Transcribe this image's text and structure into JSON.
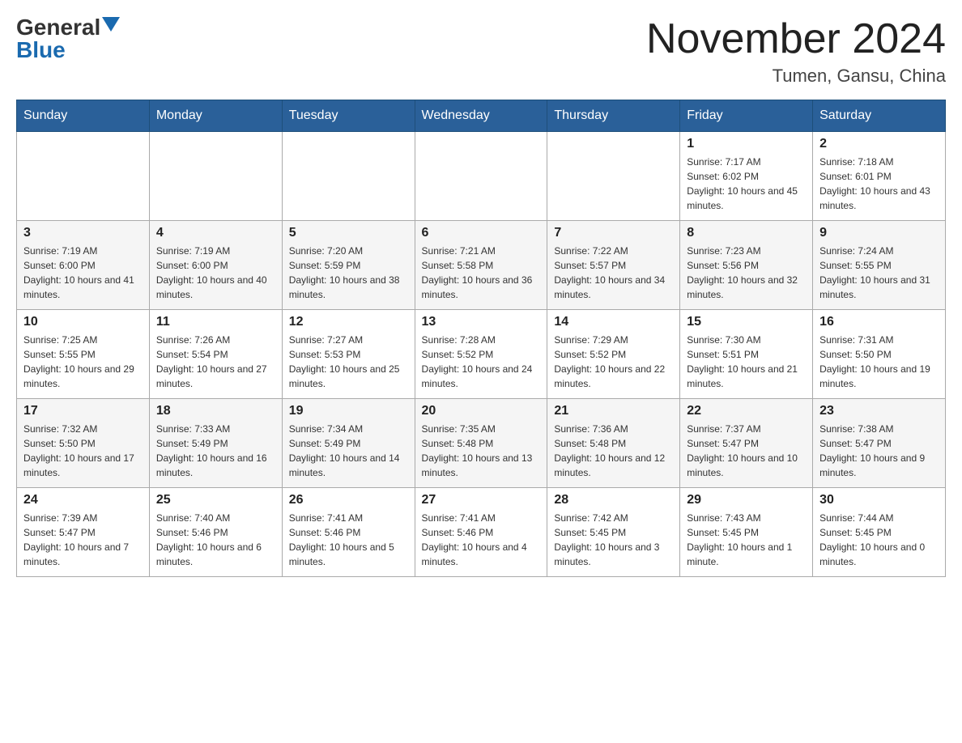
{
  "header": {
    "logo_general": "General",
    "logo_blue": "Blue",
    "month_title": "November 2024",
    "location": "Tumen, Gansu, China"
  },
  "weekdays": [
    "Sunday",
    "Monday",
    "Tuesday",
    "Wednesday",
    "Thursday",
    "Friday",
    "Saturday"
  ],
  "weeks": [
    [
      {
        "day": "",
        "sunrise": "",
        "sunset": "",
        "daylight": ""
      },
      {
        "day": "",
        "sunrise": "",
        "sunset": "",
        "daylight": ""
      },
      {
        "day": "",
        "sunrise": "",
        "sunset": "",
        "daylight": ""
      },
      {
        "day": "",
        "sunrise": "",
        "sunset": "",
        "daylight": ""
      },
      {
        "day": "",
        "sunrise": "",
        "sunset": "",
        "daylight": ""
      },
      {
        "day": "1",
        "sunrise": "Sunrise: 7:17 AM",
        "sunset": "Sunset: 6:02 PM",
        "daylight": "Daylight: 10 hours and 45 minutes."
      },
      {
        "day": "2",
        "sunrise": "Sunrise: 7:18 AM",
        "sunset": "Sunset: 6:01 PM",
        "daylight": "Daylight: 10 hours and 43 minutes."
      }
    ],
    [
      {
        "day": "3",
        "sunrise": "Sunrise: 7:19 AM",
        "sunset": "Sunset: 6:00 PM",
        "daylight": "Daylight: 10 hours and 41 minutes."
      },
      {
        "day": "4",
        "sunrise": "Sunrise: 7:19 AM",
        "sunset": "Sunset: 6:00 PM",
        "daylight": "Daylight: 10 hours and 40 minutes."
      },
      {
        "day": "5",
        "sunrise": "Sunrise: 7:20 AM",
        "sunset": "Sunset: 5:59 PM",
        "daylight": "Daylight: 10 hours and 38 minutes."
      },
      {
        "day": "6",
        "sunrise": "Sunrise: 7:21 AM",
        "sunset": "Sunset: 5:58 PM",
        "daylight": "Daylight: 10 hours and 36 minutes."
      },
      {
        "day": "7",
        "sunrise": "Sunrise: 7:22 AM",
        "sunset": "Sunset: 5:57 PM",
        "daylight": "Daylight: 10 hours and 34 minutes."
      },
      {
        "day": "8",
        "sunrise": "Sunrise: 7:23 AM",
        "sunset": "Sunset: 5:56 PM",
        "daylight": "Daylight: 10 hours and 32 minutes."
      },
      {
        "day": "9",
        "sunrise": "Sunrise: 7:24 AM",
        "sunset": "Sunset: 5:55 PM",
        "daylight": "Daylight: 10 hours and 31 minutes."
      }
    ],
    [
      {
        "day": "10",
        "sunrise": "Sunrise: 7:25 AM",
        "sunset": "Sunset: 5:55 PM",
        "daylight": "Daylight: 10 hours and 29 minutes."
      },
      {
        "day": "11",
        "sunrise": "Sunrise: 7:26 AM",
        "sunset": "Sunset: 5:54 PM",
        "daylight": "Daylight: 10 hours and 27 minutes."
      },
      {
        "day": "12",
        "sunrise": "Sunrise: 7:27 AM",
        "sunset": "Sunset: 5:53 PM",
        "daylight": "Daylight: 10 hours and 25 minutes."
      },
      {
        "day": "13",
        "sunrise": "Sunrise: 7:28 AM",
        "sunset": "Sunset: 5:52 PM",
        "daylight": "Daylight: 10 hours and 24 minutes."
      },
      {
        "day": "14",
        "sunrise": "Sunrise: 7:29 AM",
        "sunset": "Sunset: 5:52 PM",
        "daylight": "Daylight: 10 hours and 22 minutes."
      },
      {
        "day": "15",
        "sunrise": "Sunrise: 7:30 AM",
        "sunset": "Sunset: 5:51 PM",
        "daylight": "Daylight: 10 hours and 21 minutes."
      },
      {
        "day": "16",
        "sunrise": "Sunrise: 7:31 AM",
        "sunset": "Sunset: 5:50 PM",
        "daylight": "Daylight: 10 hours and 19 minutes."
      }
    ],
    [
      {
        "day": "17",
        "sunrise": "Sunrise: 7:32 AM",
        "sunset": "Sunset: 5:50 PM",
        "daylight": "Daylight: 10 hours and 17 minutes."
      },
      {
        "day": "18",
        "sunrise": "Sunrise: 7:33 AM",
        "sunset": "Sunset: 5:49 PM",
        "daylight": "Daylight: 10 hours and 16 minutes."
      },
      {
        "day": "19",
        "sunrise": "Sunrise: 7:34 AM",
        "sunset": "Sunset: 5:49 PM",
        "daylight": "Daylight: 10 hours and 14 minutes."
      },
      {
        "day": "20",
        "sunrise": "Sunrise: 7:35 AM",
        "sunset": "Sunset: 5:48 PM",
        "daylight": "Daylight: 10 hours and 13 minutes."
      },
      {
        "day": "21",
        "sunrise": "Sunrise: 7:36 AM",
        "sunset": "Sunset: 5:48 PM",
        "daylight": "Daylight: 10 hours and 12 minutes."
      },
      {
        "day": "22",
        "sunrise": "Sunrise: 7:37 AM",
        "sunset": "Sunset: 5:47 PM",
        "daylight": "Daylight: 10 hours and 10 minutes."
      },
      {
        "day": "23",
        "sunrise": "Sunrise: 7:38 AM",
        "sunset": "Sunset: 5:47 PM",
        "daylight": "Daylight: 10 hours and 9 minutes."
      }
    ],
    [
      {
        "day": "24",
        "sunrise": "Sunrise: 7:39 AM",
        "sunset": "Sunset: 5:47 PM",
        "daylight": "Daylight: 10 hours and 7 minutes."
      },
      {
        "day": "25",
        "sunrise": "Sunrise: 7:40 AM",
        "sunset": "Sunset: 5:46 PM",
        "daylight": "Daylight: 10 hours and 6 minutes."
      },
      {
        "day": "26",
        "sunrise": "Sunrise: 7:41 AM",
        "sunset": "Sunset: 5:46 PM",
        "daylight": "Daylight: 10 hours and 5 minutes."
      },
      {
        "day": "27",
        "sunrise": "Sunrise: 7:41 AM",
        "sunset": "Sunset: 5:46 PM",
        "daylight": "Daylight: 10 hours and 4 minutes."
      },
      {
        "day": "28",
        "sunrise": "Sunrise: 7:42 AM",
        "sunset": "Sunset: 5:45 PM",
        "daylight": "Daylight: 10 hours and 3 minutes."
      },
      {
        "day": "29",
        "sunrise": "Sunrise: 7:43 AM",
        "sunset": "Sunset: 5:45 PM",
        "daylight": "Daylight: 10 hours and 1 minute."
      },
      {
        "day": "30",
        "sunrise": "Sunrise: 7:44 AM",
        "sunset": "Sunset: 5:45 PM",
        "daylight": "Daylight: 10 hours and 0 minutes."
      }
    ]
  ]
}
